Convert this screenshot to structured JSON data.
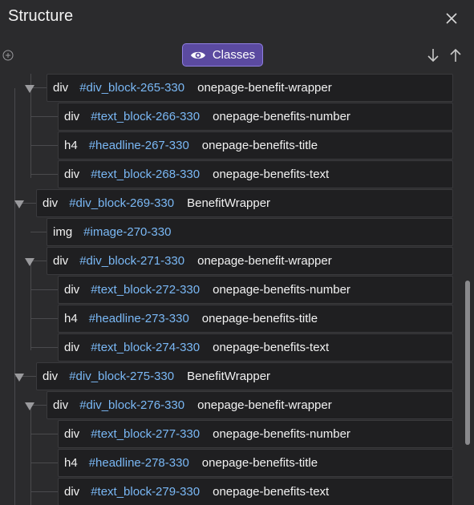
{
  "header": {
    "title": "Structure"
  },
  "toolbar": {
    "classes_label": "Classes"
  },
  "rows": [
    {
      "tag": "div",
      "id": "#div_block-265-330",
      "cls": "onepage-benefit-wrapper"
    },
    {
      "tag": "div",
      "id": "#text_block-266-330",
      "cls": "onepage-benefits-number"
    },
    {
      "tag": "h4",
      "id": "#headline-267-330",
      "cls": "onepage-benefits-title"
    },
    {
      "tag": "div",
      "id": "#text_block-268-330",
      "cls": "onepage-benefits-text"
    },
    {
      "tag": "div",
      "id": "#div_block-269-330",
      "cls": "BenefitWrapper"
    },
    {
      "tag": "img",
      "id": "#image-270-330",
      "cls": ""
    },
    {
      "tag": "div",
      "id": "#div_block-271-330",
      "cls": "onepage-benefit-wrapper"
    },
    {
      "tag": "div",
      "id": "#text_block-272-330",
      "cls": "onepage-benefits-number"
    },
    {
      "tag": "h4",
      "id": "#headline-273-330",
      "cls": "onepage-benefits-title"
    },
    {
      "tag": "div",
      "id": "#text_block-274-330",
      "cls": "onepage-benefits-text"
    },
    {
      "tag": "div",
      "id": "#div_block-275-330",
      "cls": "BenefitWrapper"
    },
    {
      "tag": "div",
      "id": "#div_block-276-330",
      "cls": "onepage-benefit-wrapper"
    },
    {
      "tag": "div",
      "id": "#text_block-277-330",
      "cls": "onepage-benefits-number"
    },
    {
      "tag": "h4",
      "id": "#headline-278-330",
      "cls": "onepage-benefits-title"
    },
    {
      "tag": "div",
      "id": "#text_block-279-330",
      "cls": "onepage-benefits-text"
    }
  ]
}
